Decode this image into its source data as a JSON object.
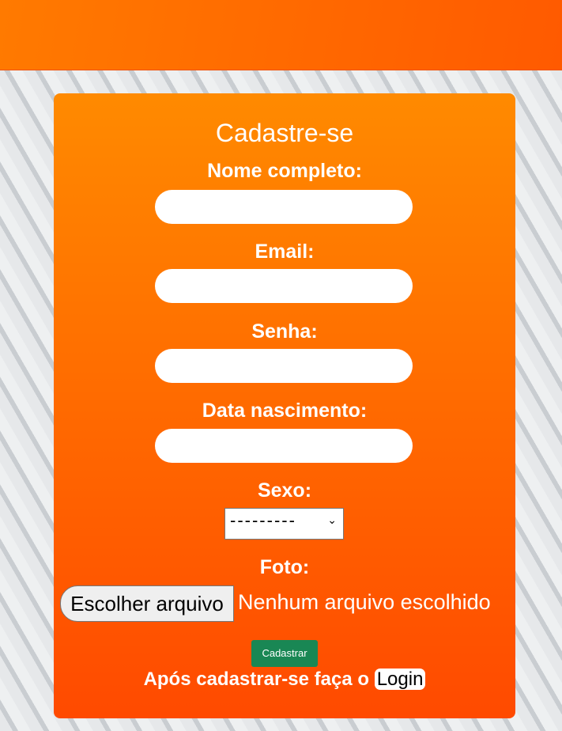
{
  "form": {
    "title": "Cadastre-se",
    "name_label": "Nome completo:",
    "email_label": "Email:",
    "password_label": "Senha:",
    "birth_label": "Data nascimento:",
    "sex_label": "Sexo:",
    "sex_selected": "---------",
    "photo_label": "Foto:",
    "file_button": "Escolher arquivo",
    "file_status": "Nenhum arquivo escolhido",
    "submit": "Cadastrar",
    "after_text": "Após cadastrar-se faça o",
    "login_link": "Login"
  }
}
